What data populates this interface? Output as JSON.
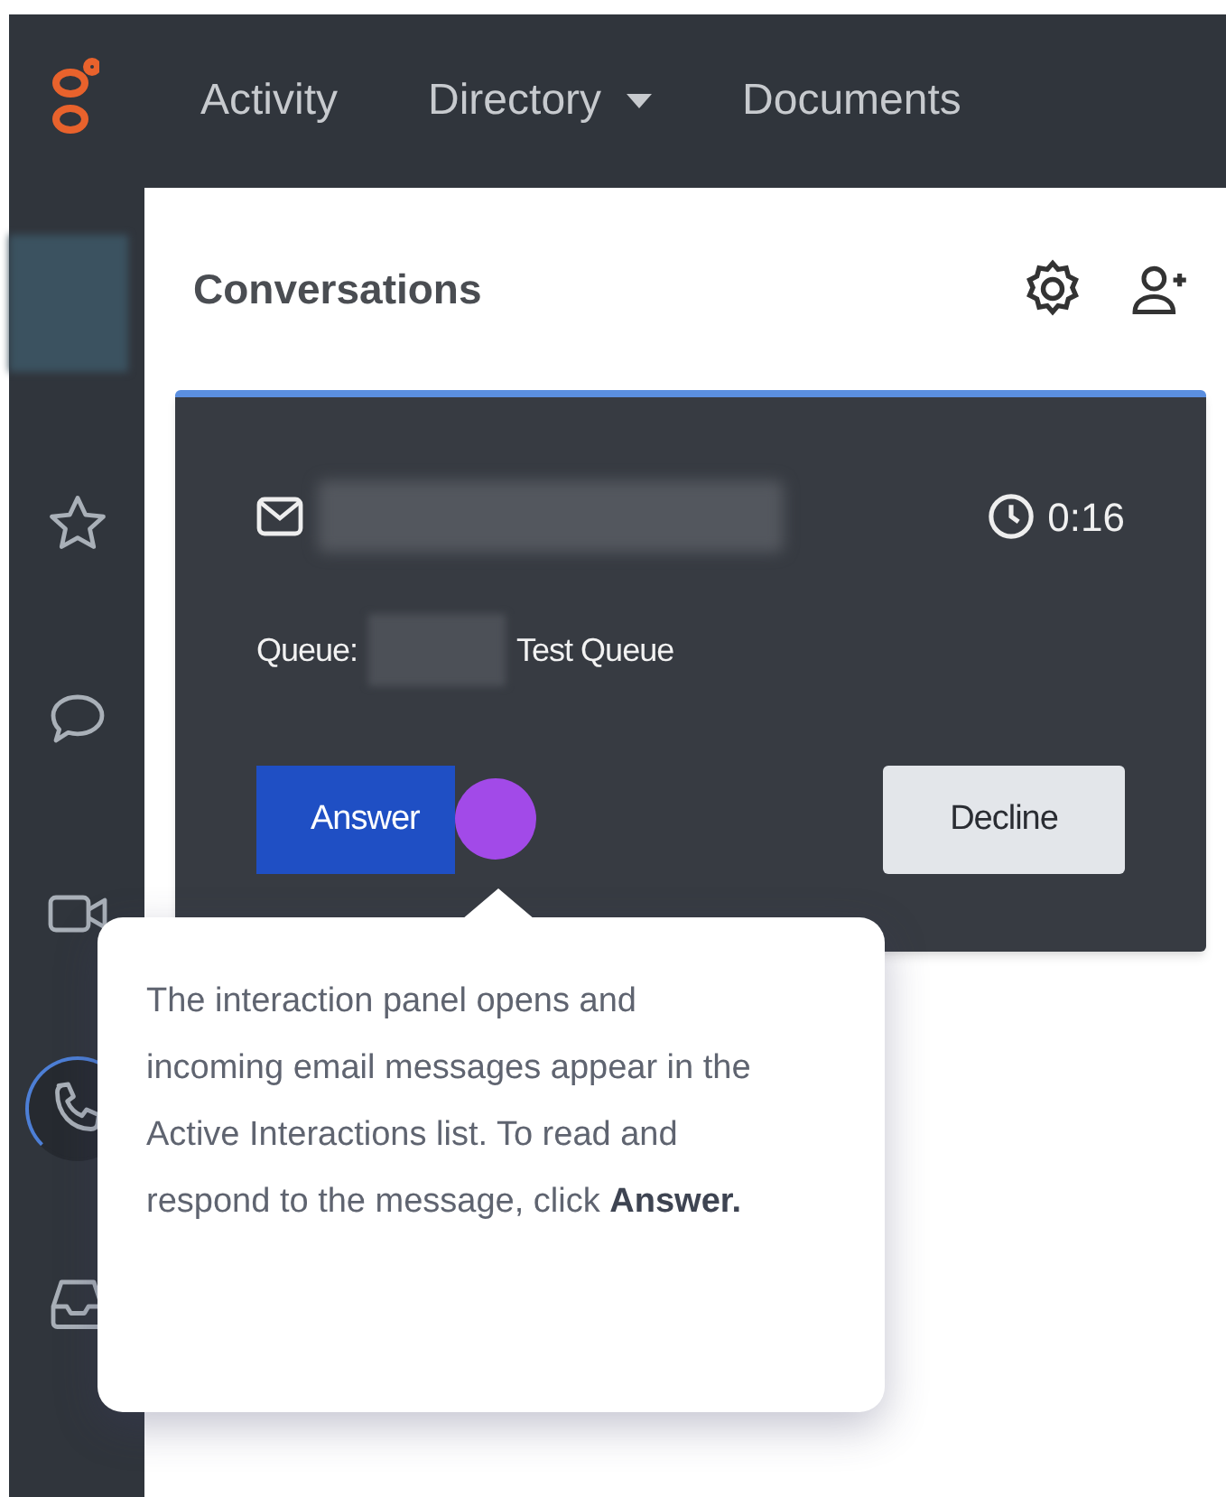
{
  "top_nav": {
    "items": [
      {
        "label": "Activity",
        "dropdown": false
      },
      {
        "label": "Directory",
        "dropdown": true
      },
      {
        "label": "Documents",
        "dropdown": false
      }
    ]
  },
  "sidebar": {
    "items": [
      {
        "kind": "star",
        "selected": false
      },
      {
        "kind": "chat",
        "selected": false
      },
      {
        "kind": "video",
        "selected": false
      },
      {
        "kind": "phone",
        "selected": true
      },
      {
        "kind": "inbox",
        "selected": false
      }
    ]
  },
  "panel": {
    "title": "Conversations"
  },
  "conversation": {
    "timer": "0:16",
    "queue_label": "Queue:",
    "queue_name": "Test Queue",
    "buttons": [
      {
        "label": "Answer",
        "kind": "primary"
      },
      {
        "label": "Decline",
        "kind": "secondary"
      }
    ]
  },
  "tooltip": {
    "text": "The interaction panel opens and incoming email messages appear in the Active Interactions list. To read and respond to the message, click **Answer.**"
  }
}
